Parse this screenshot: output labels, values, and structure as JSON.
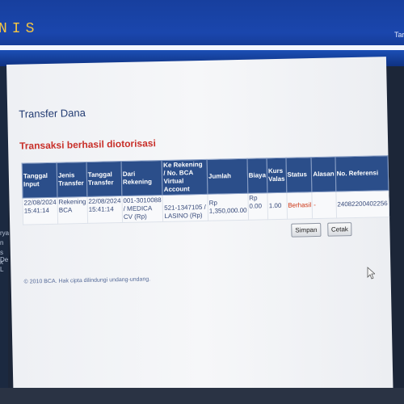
{
  "brand": "NIS",
  "brand_right": "Tar",
  "sidebar_fragments": [
    "rya",
    "n",
    "s De",
    "k L"
  ],
  "page_title": "Transfer Dana",
  "message": "Transaksi berhasil diotorisasi",
  "table": {
    "headers": [
      "Tanggal Input",
      "Jenis Transfer",
      "Tanggal Transfer",
      "Dari Rekening",
      "Ke Rekening / No. BCA Virtual Account",
      "Jumlah",
      "Biaya",
      "Kurs Valas",
      "Status",
      "Alasan",
      "No. Referensi"
    ],
    "rows": [
      {
        "tanggal_input": "22/08/2024 15:41:14",
        "jenis_transfer": "Rekening BCA",
        "tanggal_transfer": "22/08/2024 15:41:14",
        "dari_rekening": "001-3010088 / MEDICA CV (Rp)",
        "ke_rekening": "521-1347105 / LASINO (Rp)",
        "jumlah": "Rp 1,350,000.00",
        "biaya": "Rp 0.00",
        "kurs": "1.00",
        "status": "Berhasil",
        "alasan": "-",
        "no_referensi": "24082200402256"
      }
    ]
  },
  "buttons": {
    "simpan": "Simpan",
    "cetak": "Cetak"
  },
  "footer": "© 2010 BCA. Hak cipta dilindungi undang-undang."
}
